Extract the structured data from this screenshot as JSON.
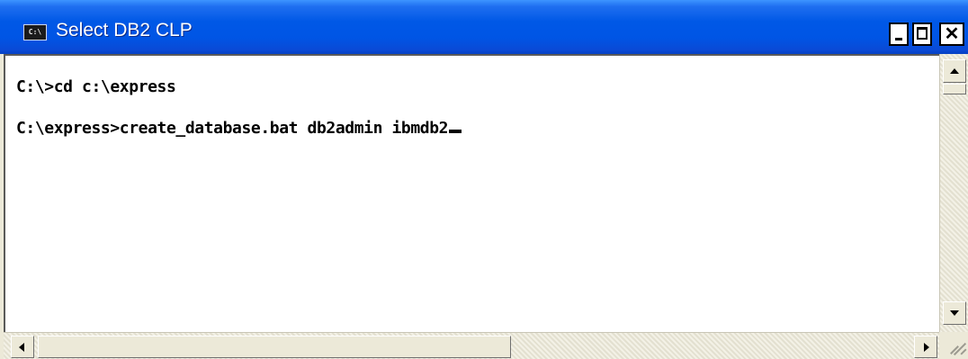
{
  "window": {
    "title": "Select DB2 CLP",
    "icon": "console-icon",
    "icon_text": "C:\\",
    "title_color": "#ffffff",
    "titlebar_color": "#0058e6"
  },
  "caption_buttons": {
    "minimize_icon": "minimize-icon",
    "maximize_icon": "maximize-icon",
    "close_icon": "close-icon",
    "close_glyph": "✕"
  },
  "console": {
    "lines": [
      "C:\\>cd c:\\express",
      "C:\\express>create_database.bat db2admin ibmdb2"
    ],
    "cursor": "underscore-cursor",
    "background": "#ffffff",
    "text_color": "#000000"
  },
  "scrollbars": {
    "vertical": {
      "up_icon": "arrow-up-icon",
      "down_icon": "arrow-down-icon"
    },
    "horizontal": {
      "left_icon": "arrow-left-icon",
      "right_icon": "arrow-right-icon"
    }
  }
}
